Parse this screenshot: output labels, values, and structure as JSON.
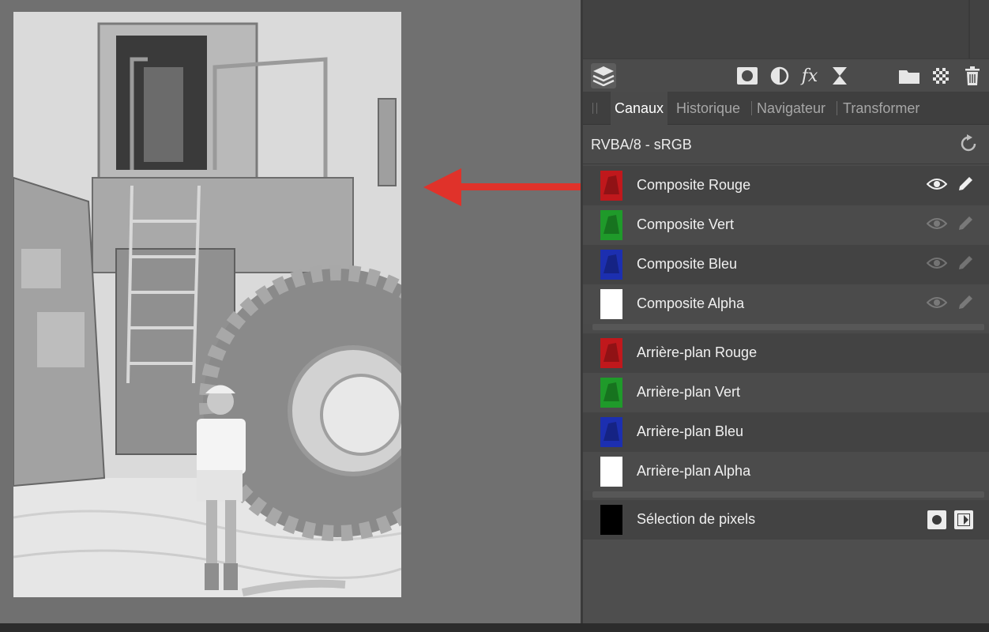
{
  "toolbar": {
    "icons": [
      "layers-icon",
      "mask-icon",
      "adjustment-icon",
      "fx-icon",
      "hourglass-icon",
      "folder-icon",
      "checker-icon",
      "trash-icon"
    ],
    "fx_label": "fx"
  },
  "tabs": [
    {
      "label": "Canaux",
      "active": true
    },
    {
      "label": "Historique",
      "active": false
    },
    {
      "label": "Navigateur",
      "active": false
    },
    {
      "label": "Transformer",
      "active": false
    }
  ],
  "format": {
    "label": "RVBA/8 - sRGB",
    "icon": "refresh-icon"
  },
  "composite": [
    {
      "label": "Composite Rouge",
      "color": "#c0181c",
      "visible": true
    },
    {
      "label": "Composite Vert",
      "color": "#1f9a2a",
      "visible": false
    },
    {
      "label": "Composite Bleu",
      "color": "#1c2fb0",
      "visible": false
    },
    {
      "label": "Composite Alpha",
      "color": "#ffffff",
      "visible": false
    }
  ],
  "background": [
    {
      "label": "Arrière-plan Rouge",
      "color": "#c0181c"
    },
    {
      "label": "Arrière-plan Vert",
      "color": "#1f9a2a"
    },
    {
      "label": "Arrière-plan Bleu",
      "color": "#1c2fb0"
    },
    {
      "label": "Arrière-plan Alpha",
      "color": "#ffffff"
    }
  ],
  "selection": {
    "label": "Sélection de pixels",
    "color": "#000000"
  },
  "colors": {
    "arrow": "#e0322a",
    "panel_bg": "#4a4a4a",
    "canvas_bg": "#707070"
  }
}
